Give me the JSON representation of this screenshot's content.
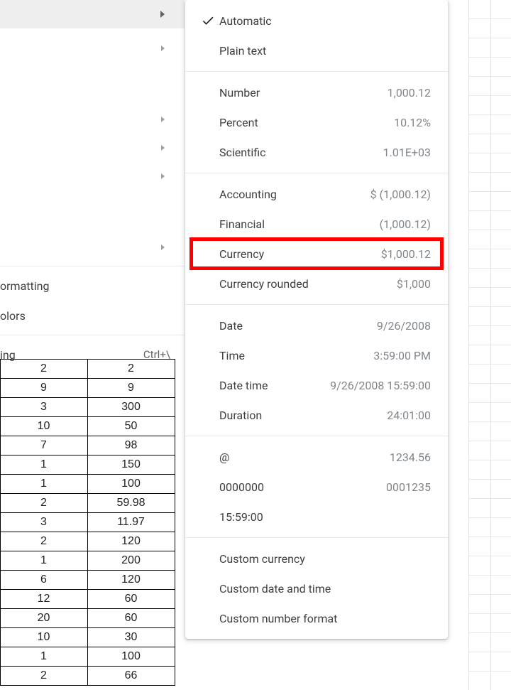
{
  "parent_menu": {
    "arrow_rows": 6,
    "text_items": [
      {
        "label": "ormatting",
        "shortcut": ""
      },
      {
        "label": "olors",
        "shortcut": ""
      }
    ],
    "clear_row": {
      "label": "ing",
      "shortcut": "Ctrl+\\"
    }
  },
  "format_popup": {
    "group1": [
      {
        "id": "automatic",
        "label": "Automatic",
        "example": "",
        "checked": true
      },
      {
        "id": "plaintext",
        "label": "Plain text",
        "example": "",
        "checked": false
      }
    ],
    "group2": [
      {
        "id": "number",
        "label": "Number",
        "example": "1,000.12"
      },
      {
        "id": "percent",
        "label": "Percent",
        "example": "10.12%"
      },
      {
        "id": "scientific",
        "label": "Scientific",
        "example": "1.01E+03"
      }
    ],
    "group3": [
      {
        "id": "accounting",
        "label": "Accounting",
        "example": "$ (1,000.12)"
      },
      {
        "id": "financial",
        "label": "Financial",
        "example": "(1,000.12)"
      },
      {
        "id": "currency",
        "label": "Currency",
        "example": "$1,000.12",
        "highlight": true
      },
      {
        "id": "currency-rounded",
        "label": "Currency rounded",
        "example": "$1,000"
      }
    ],
    "group4": [
      {
        "id": "date",
        "label": "Date",
        "example": "9/26/2008"
      },
      {
        "id": "time",
        "label": "Time",
        "example": "3:59:00 PM"
      },
      {
        "id": "datetime",
        "label": "Date time",
        "example": "9/26/2008 15:59:00"
      },
      {
        "id": "duration",
        "label": "Duration",
        "example": "24:01:00"
      }
    ],
    "group5": [
      {
        "id": "at",
        "label": "@",
        "example": "1234.56"
      },
      {
        "id": "zeros",
        "label": "0000000",
        "example": "0001235"
      },
      {
        "id": "timefmt",
        "label": "15:59:00",
        "example": ""
      }
    ],
    "group6": [
      {
        "id": "custom-currency",
        "label": "Custom currency"
      },
      {
        "id": "custom-datetime",
        "label": "Custom date and time"
      },
      {
        "id": "custom-number",
        "label": "Custom number format"
      }
    ]
  },
  "table": {
    "rows": [
      [
        2,
        2
      ],
      [
        9,
        9
      ],
      [
        3,
        300
      ],
      [
        10,
        50
      ],
      [
        7,
        98
      ],
      [
        1,
        150
      ],
      [
        1,
        100
      ],
      [
        2,
        59.98
      ],
      [
        3,
        11.97
      ],
      [
        2,
        120
      ],
      [
        1,
        200
      ],
      [
        6,
        120
      ],
      [
        12,
        60
      ],
      [
        20,
        60
      ],
      [
        10,
        30
      ],
      [
        1,
        100
      ],
      [
        2,
        66
      ]
    ]
  }
}
